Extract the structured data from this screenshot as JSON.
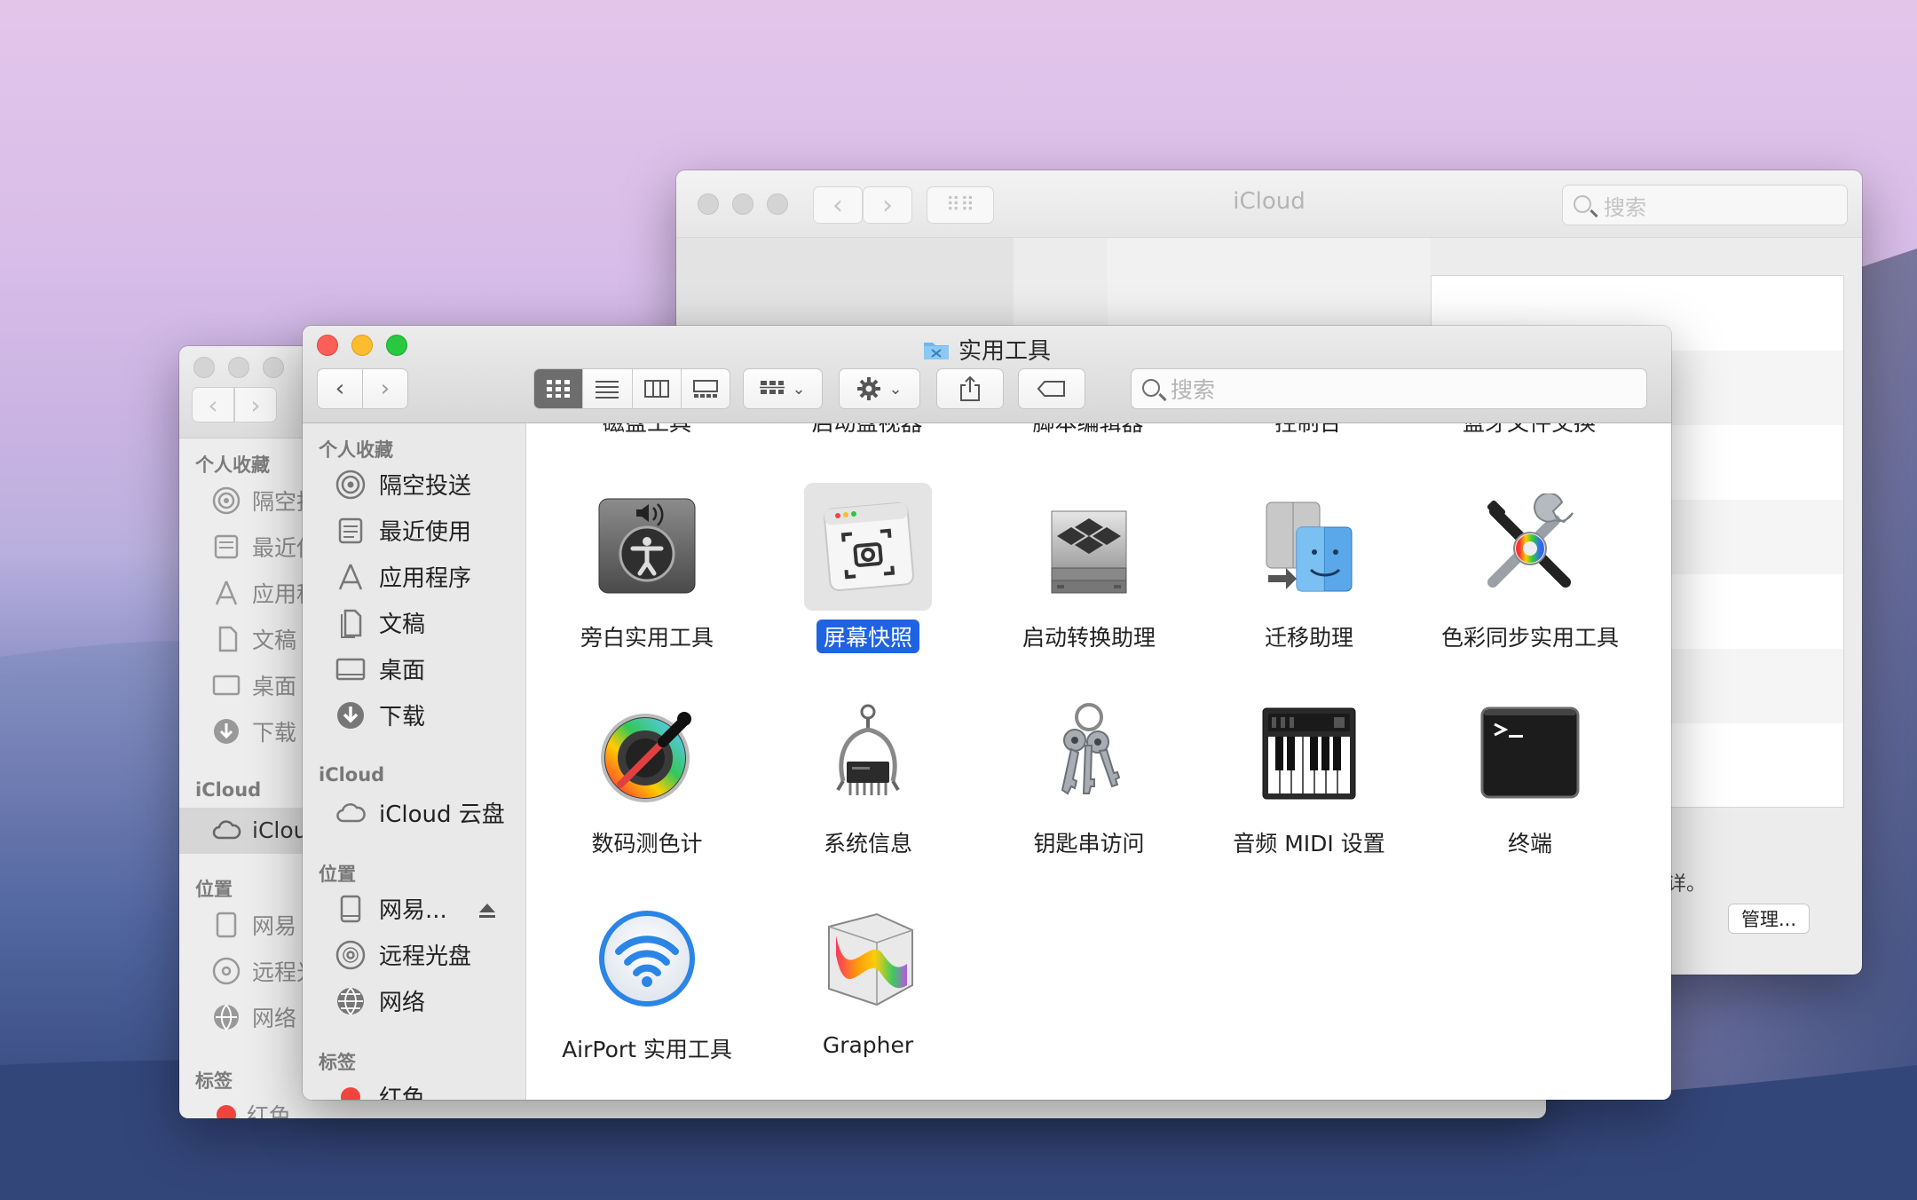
{
  "icloud_window": {
    "title": "iCloud",
    "search_placeholder": "搜索",
    "note_text": "详。",
    "manage_button": "管理..."
  },
  "back_finder": {
    "sections": [
      {
        "header": "个人收藏",
        "items": [
          "隔空投送",
          "最近使用",
          "应用程序",
          "文稿",
          "桌面",
          "下载"
        ]
      },
      {
        "header": "iCloud",
        "items": [
          "iCloud"
        ]
      },
      {
        "header": "位置",
        "items": [
          "网易",
          "远程光盘",
          "网络"
        ]
      },
      {
        "header": "标签",
        "items": [
          "红色"
        ]
      }
    ]
  },
  "finder": {
    "title": "实用工具",
    "search_placeholder": "搜索",
    "sidebar": {
      "favorites_header": "个人收藏",
      "favorites": [
        {
          "label": "隔空投送",
          "icon": "airdrop-icon"
        },
        {
          "label": "最近使用",
          "icon": "recents-icon"
        },
        {
          "label": "应用程序",
          "icon": "applications-icon"
        },
        {
          "label": "文稿",
          "icon": "documents-icon"
        },
        {
          "label": "桌面",
          "icon": "desktop-icon"
        },
        {
          "label": "下载",
          "icon": "downloads-icon"
        }
      ],
      "icloud_header": "iCloud",
      "icloud_items": [
        {
          "label": "iCloud 云盘",
          "icon": "cloud-icon"
        }
      ],
      "locations_header": "位置",
      "locations": [
        {
          "label": "网易...",
          "icon": "disk-icon"
        },
        {
          "label": "远程光盘",
          "icon": "optical-disc-icon"
        },
        {
          "label": "网络",
          "icon": "network-globe-icon"
        }
      ],
      "tags_header": "标签",
      "tags": [
        {
          "label": "红色",
          "color": "#f0443f"
        }
      ]
    },
    "cut_off_row": [
      "磁盘工具",
      "启动盘视器",
      "脚本编辑器",
      "控制台",
      "蓝牙文件交换"
    ],
    "apps": [
      {
        "label": "旁白实用工具",
        "icon": "voiceover-utility-icon",
        "selected": false
      },
      {
        "label": "屏幕快照",
        "icon": "screenshot-icon",
        "selected": true
      },
      {
        "label": "启动转换助理",
        "icon": "boot-camp-icon",
        "selected": false
      },
      {
        "label": "迁移助理",
        "icon": "migration-assistant-icon",
        "selected": false
      },
      {
        "label": "色彩同步实用工具",
        "icon": "colorsync-icon",
        "selected": false
      },
      {
        "label": "数码测色计",
        "icon": "digital-color-meter-icon",
        "selected": false
      },
      {
        "label": "系统信息",
        "icon": "system-information-icon",
        "selected": false
      },
      {
        "label": "钥匙串访问",
        "icon": "keychain-icon",
        "selected": false
      },
      {
        "label": "音频 MIDI 设置",
        "icon": "audio-midi-icon",
        "selected": false
      },
      {
        "label": "终端",
        "icon": "terminal-icon",
        "selected": false
      },
      {
        "label": "AirPort 实用工具",
        "icon": "airport-utility-icon",
        "selected": false
      },
      {
        "label": "Grapher",
        "icon": "grapher-icon",
        "selected": false
      }
    ]
  },
  "colors": {
    "selection_blue": "#1f63e3",
    "close_red": "#fc5f57",
    "minimize_yellow": "#fdbc2e",
    "zoom_green": "#28c840"
  }
}
